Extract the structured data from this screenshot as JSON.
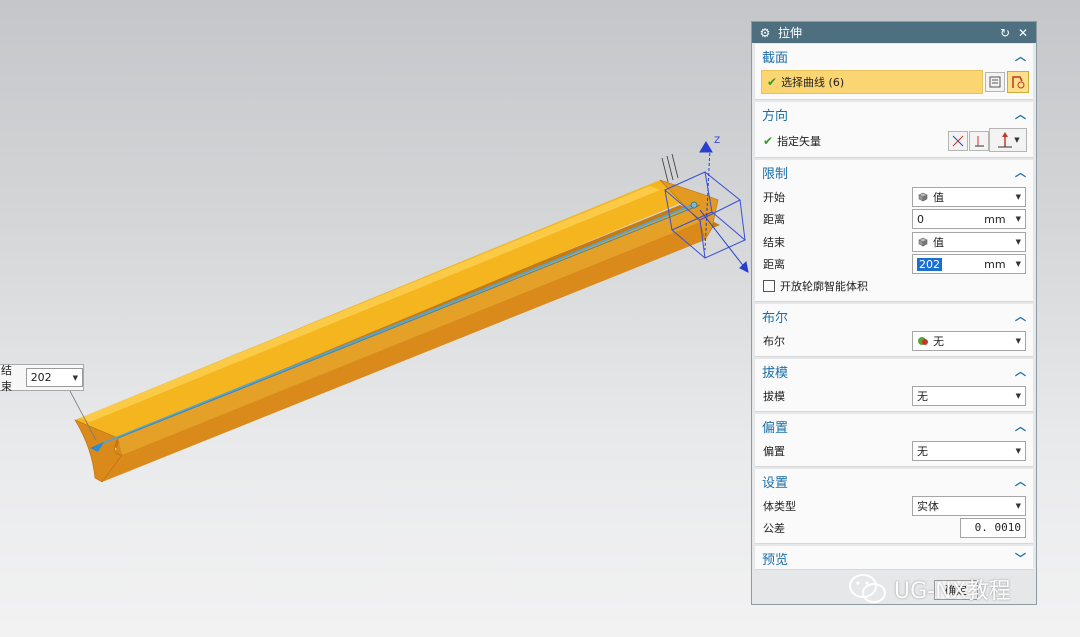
{
  "viewport": {
    "onscreen_label": "结束",
    "onscreen_value": "202",
    "axis_label": "Z"
  },
  "dialog": {
    "title": "拉伸",
    "sections": {
      "section": {
        "title": "截面",
        "select_curve": "选择曲线 (6)"
      },
      "direction": {
        "title": "方向",
        "specify_vector": "指定矢量"
      },
      "limits": {
        "title": "限制",
        "start_label": "开始",
        "start_value": "值",
        "start_dist_label": "距离",
        "start_dist": "0",
        "start_unit": "mm",
        "end_label": "结束",
        "end_value": "值",
        "end_dist_label": "距离",
        "end_dist": "202",
        "end_unit": "mm",
        "open_profile": "开放轮廓智能体积"
      },
      "boolean": {
        "title": "布尔",
        "label": "布尔",
        "value": "无"
      },
      "draft": {
        "title": "拔模",
        "label": "拔模",
        "value": "无"
      },
      "offset": {
        "title": "偏置",
        "label": "偏置",
        "value": "无"
      },
      "settings": {
        "title": "设置",
        "body_type_label": "体类型",
        "body_type": "实体",
        "tolerance_label": "公差",
        "tolerance": "0. 0010"
      },
      "preview": {
        "title": "预览"
      }
    },
    "ok_label": "确定"
  },
  "watermark": {
    "text": "UG-NX教程"
  },
  "colors": {
    "title_bar": "#4d6f80",
    "section_heading": "#1b6fa8",
    "selection_highlight": "#fbd572",
    "part_yellow": "#f4b51f",
    "part_orange": "#d8891a"
  }
}
